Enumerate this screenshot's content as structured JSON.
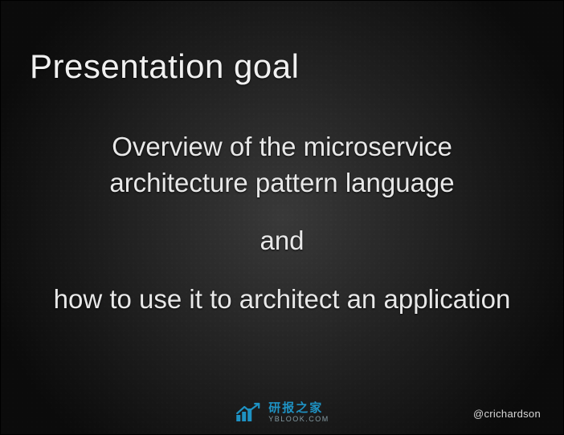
{
  "slide": {
    "title": "Presentation goal",
    "body_line1": "Overview of the microservice architecture pattern language",
    "body_line2": "and",
    "body_line3": "how to use it to architect an application",
    "handle": "@crichardson"
  },
  "watermark": {
    "icon_name": "chart-arrow-icon",
    "cn": "研报之家",
    "en": "YBLOOK.COM"
  }
}
